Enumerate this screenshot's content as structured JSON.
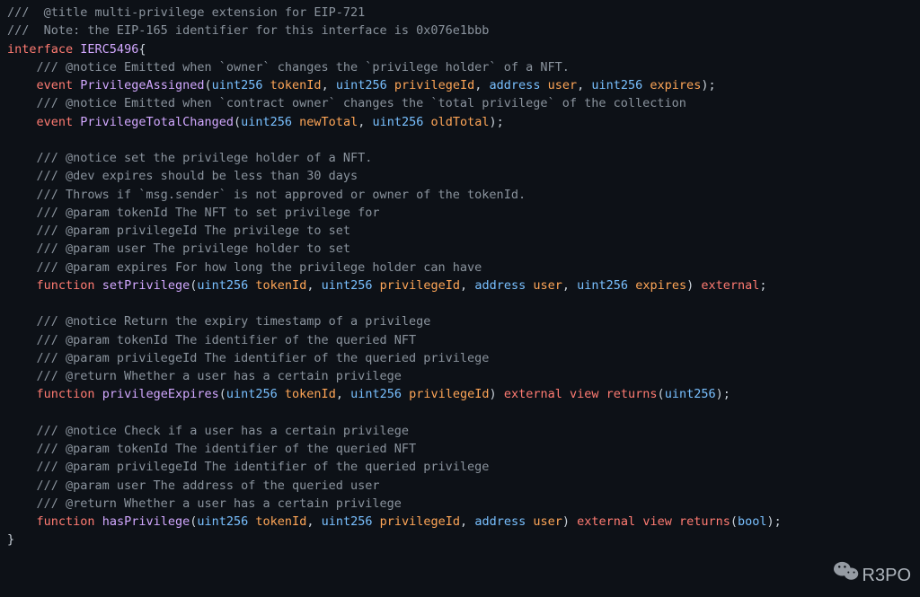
{
  "code": {
    "line01_comment": "///  @title multi-privilege extension for EIP-721",
    "line02_comment": "///  Note: the EIP-165 identifier for this interface is 0x076e1bbb",
    "kw_interface": "interface",
    "name_interface": "IERC5496",
    "brace_open": "{",
    "line04_comment": "/// @notice Emitted when `owner` changes the `privilege holder` of a NFT.",
    "kw_event": "event",
    "name_event1": "PrivilegeAssigned",
    "type_uint256": "uint256",
    "type_address": "address",
    "type_bool": "bool",
    "param_tokenId": "tokenId",
    "param_privilegeId": "privilegeId",
    "param_user": "user",
    "param_expires": "expires",
    "line06_comment": "/// @notice Emitted when `contract owner` changes the `total privilege` of the collection",
    "name_event2": "PrivilegeTotalChanged",
    "param_newTotal": "newTotal",
    "param_oldTotal": "oldTotal",
    "line09_comment": "/// @notice set the privilege holder of a NFT.",
    "line10_comment": "/// @dev expires should be less than 30 days",
    "line11_comment": "/// Throws if `msg.sender` is not approved or owner of the tokenId.",
    "line12_comment": "/// @param tokenId The NFT to set privilege for",
    "line13_comment": "/// @param privilegeId The privilege to set",
    "line14_comment": "/// @param user The privilege holder to set",
    "line15_comment": "/// @param expires For how long the privilege holder can have",
    "kw_function": "function",
    "name_fn1": "setPrivilege",
    "kw_external": "external",
    "line18_comment": "/// @notice Return the expiry timestamp of a privilege",
    "line19_comment": "/// @param tokenId The identifier of the queried NFT",
    "line20_comment": "/// @param privilegeId The identifier of the queried privilege",
    "line21_comment": "/// @return Whether a user has a certain privilege",
    "name_fn2": "privilegeExpires",
    "kw_view": "view",
    "kw_returns": "returns",
    "line24_comment": "/// @notice Check if a user has a certain privilege",
    "line25_comment": "/// @param tokenId The identifier of the queried NFT",
    "line26_comment": "/// @param privilegeId The identifier of the queried privilege",
    "line27_comment": "/// @param user The address of the queried user",
    "line28_comment": "/// @return Whether a user has a certain privilege",
    "name_fn3": "hasPrivilege",
    "brace_close": "}"
  },
  "watermark": {
    "text": "R3PO"
  }
}
